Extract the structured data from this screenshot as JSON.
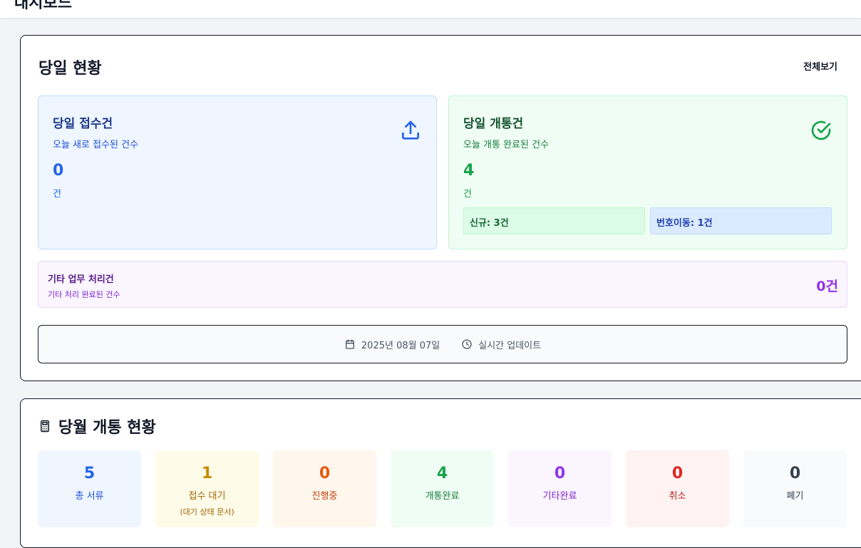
{
  "header": {
    "title": "대시보드"
  },
  "today": {
    "title": "당일 현황",
    "view_all": "전체보기",
    "received": {
      "title": "당일 접수건",
      "subtitle": "오늘 새로 접수된 건수",
      "count": "0",
      "unit": "건",
      "icon": "upload-icon"
    },
    "opened": {
      "title": "당일 개통건",
      "subtitle": "오늘 개통 완료된 건수",
      "count": "4",
      "unit": "건",
      "icon": "check-circle-icon",
      "new_chip": "신규: 3건",
      "port_chip": "번호이동: 1건"
    },
    "other": {
      "title": "기타 업무 처리건",
      "subtitle": "기타 처리 완료된 건수",
      "count": "0건"
    },
    "footer": {
      "date": "2025년 08월 07일",
      "realtime": "실시간 업데이트"
    }
  },
  "month": {
    "title": "당월 개통 현황",
    "stats": [
      {
        "value": "5",
        "label": "총 서류",
        "note": "",
        "bg": "#eff6ff",
        "num_color": "#2563eb",
        "label_color": "#1d4ed8"
      },
      {
        "value": "1",
        "label": "접수 대기",
        "note": "(대기 상태 문서)",
        "bg": "#fefce8",
        "num_color": "#ca8a04",
        "label_color": "#a16207"
      },
      {
        "value": "0",
        "label": "진행중",
        "note": "",
        "bg": "#fff7ed",
        "num_color": "#ea580c",
        "label_color": "#c2410c"
      },
      {
        "value": "4",
        "label": "개통완료",
        "note": "",
        "bg": "#f0fdf4",
        "num_color": "#16a34a",
        "label_color": "#15803d"
      },
      {
        "value": "0",
        "label": "기타완료",
        "note": "",
        "bg": "#faf5ff",
        "num_color": "#9333ea",
        "label_color": "#7e22ce"
      },
      {
        "value": "0",
        "label": "취소",
        "note": "",
        "bg": "#fef2f2",
        "num_color": "#dc2626",
        "label_color": "#b91c1c"
      },
      {
        "value": "0",
        "label": "폐기",
        "note": "",
        "bg": "#f9fafb",
        "num_color": "#374151",
        "label_color": "#374151"
      }
    ]
  }
}
